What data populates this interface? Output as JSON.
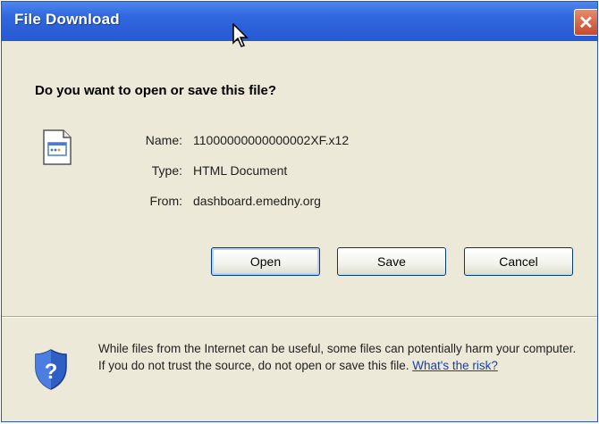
{
  "window": {
    "title": "File Download",
    "close_label": "✕"
  },
  "dialog": {
    "question": "Do you want to open or save this file?",
    "file": {
      "name_label": "Name:",
      "name_value": "11000000000000002XF.x12",
      "type_label": "Type:",
      "type_value": "HTML Document",
      "from_label": "From:",
      "from_value": "dashboard.emedny.org"
    },
    "buttons": {
      "open": "Open",
      "save": "Save",
      "cancel": "Cancel"
    },
    "warning": {
      "text": "While files from the Internet can be useful, some files can potentially harm your computer. If you do not trust the source, do not open or save this file.",
      "link": "What's the risk?"
    },
    "icons": {
      "file": "html-document-icon",
      "shield": "security-shield-icon",
      "cursor": "mouse-pointer-icon"
    }
  }
}
